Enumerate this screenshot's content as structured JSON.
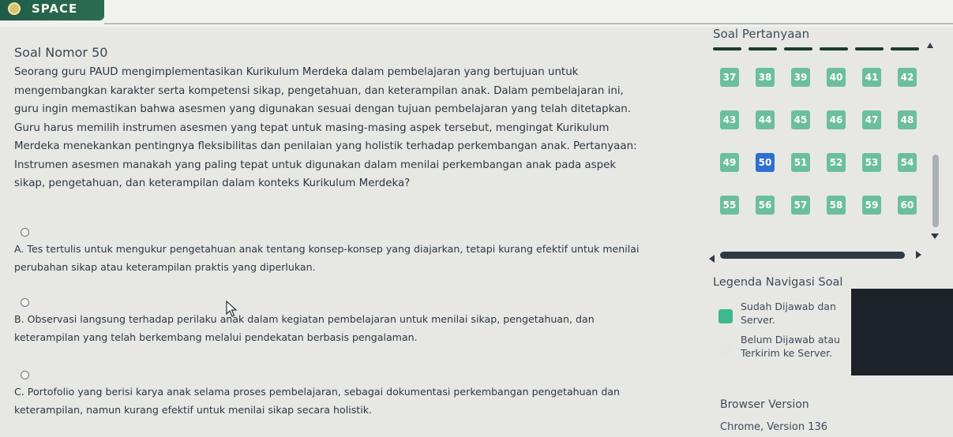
{
  "header": {
    "logo_text": "SPACE",
    "logo_icon": "seal-icon"
  },
  "question": {
    "number_label": "Soal Nomor 50",
    "text": "Seorang guru PAUD mengimplementasikan Kurikulum Merdeka dalam pembelajaran yang bertujuan untuk\nmengembangkan karakter serta kompetensi sikap, pengetahuan, dan keterampilan anak. Dalam pembelajaran ini,\nguru ingin memastikan bahwa asesmen yang digunakan sesuai dengan tujuan pembelajaran yang telah ditetapkan.\nGuru harus memilih instrumen asesmen yang tepat untuk masing-masing aspek tersebut, mengingat Kurikulum\nMerdeka menekankan pentingnya fleksibilitas dan penilaian yang holistik terhadap perkembangan anak. Pertanyaan:\nInstrumen asesmen manakah yang paling tepat untuk digunakan dalam menilai perkembangan anak pada aspek\nsikap, pengetahuan, dan keterampilan dalam konteks Kurikulum Merdeka?",
    "options": [
      {
        "text": "A. Tes tertulis untuk mengukur pengetahuan anak tentang konsep-konsep yang diajarkan, tetapi kurang efektif untuk menilai\nperubahan sikap atau keterampilan praktis yang diperlukan."
      },
      {
        "text": "B. Observasi langsung terhadap perilaku anak dalam kegiatan pembelajaran untuk menilai sikap, pengetahuan, dan\nketerampilan yang telah berkembang melalui pendekatan berbasis pengalaman."
      },
      {
        "text": "C. Portofolio yang berisi karya anak selama proses pembelajaran, sebagai dokumentasi perkembangan pengetahuan dan\nketerampilan, namun kurang efektif untuk menilai sikap secara holistik."
      }
    ]
  },
  "panel": {
    "title": "Soal Pertanyaan",
    "numbers": [
      "37",
      "38",
      "39",
      "40",
      "41",
      "42",
      "43",
      "44",
      "45",
      "46",
      "47",
      "48",
      "49",
      "50",
      "51",
      "52",
      "53",
      "54",
      "55",
      "56",
      "57",
      "58",
      "59",
      "60"
    ],
    "current": "50",
    "colors": {
      "answered": "#6bbf9c",
      "current": "#2f6fd0",
      "unanswered": "#e6e7e3"
    }
  },
  "legend": {
    "title": "Legenda Navigasi Soal",
    "items": [
      {
        "label": "Sudah Dijawab dan\nServer.",
        "color": "#3db88f"
      },
      {
        "label": "Belum Dijawab atau\nTerkirim ke Server.",
        "color": "#e6e7e3"
      }
    ]
  },
  "browser": {
    "title": "Browser Version",
    "value": "Chrome, Version 136"
  }
}
